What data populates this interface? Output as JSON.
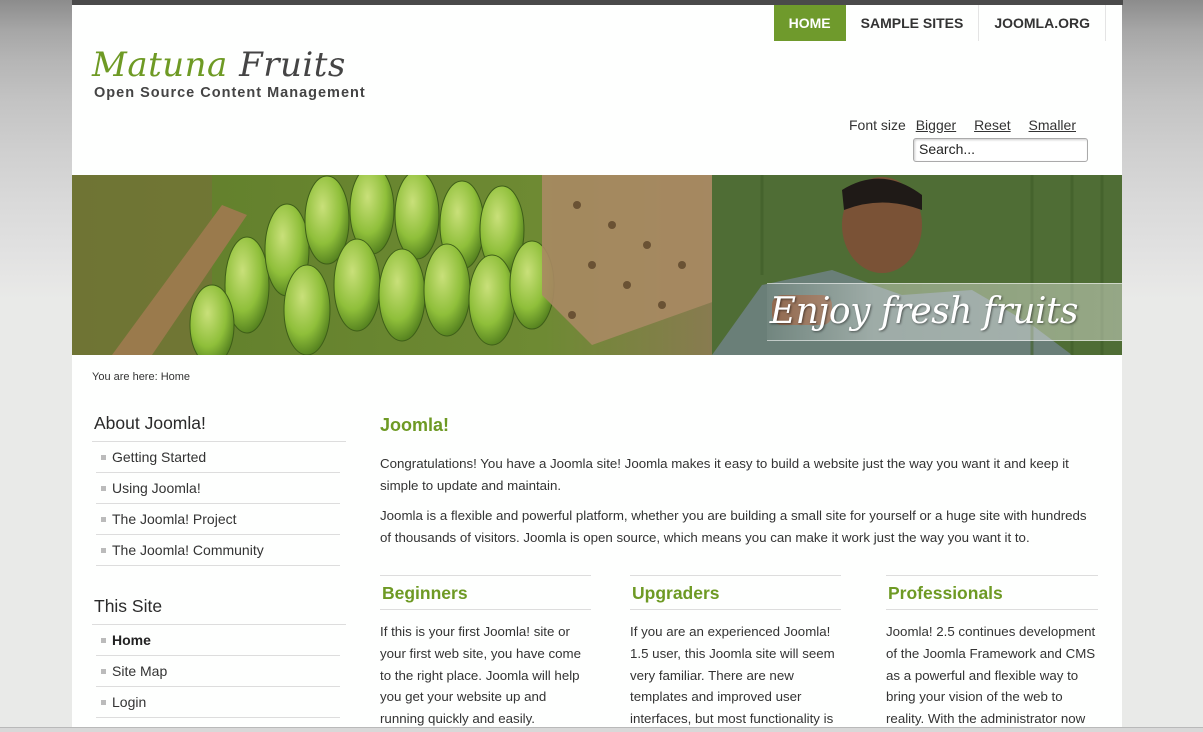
{
  "nav": {
    "items": [
      "HOME",
      "SAMPLE SITES",
      "JOOMLA.ORG"
    ]
  },
  "logo": {
    "word1": "Matuna",
    "word2": "Fruits",
    "tagline": "Open Source Content Management"
  },
  "tools": {
    "font_size_label": "Font size",
    "bigger": "Bigger",
    "reset": "Reset",
    "smaller": "Smaller"
  },
  "search": {
    "value": "Search..."
  },
  "banner": {
    "caption": "Enjoy fresh fruits"
  },
  "breadcrumb": "You are here: Home",
  "sidebar": {
    "about_title": "About Joomla!",
    "about_items": [
      "Getting Started",
      "Using Joomla!",
      "The Joomla! Project",
      "The Joomla! Community"
    ],
    "site_title": "This Site",
    "site_items": [
      "Home",
      "Site Map",
      "Login"
    ]
  },
  "main": {
    "title": "Joomla!",
    "para1": "Congratulations! You have a Joomla site! Joomla makes it easy to build a website just the way you want it and keep it simple to update and maintain.",
    "para2": "Joomla is a flexible and powerful platform, whether you are building a small site for yourself or a huge site with hundreds of thousands of visitors. Joomla is open source, which means you can make it work just the way you want it to.",
    "columns": [
      {
        "title": "Beginners",
        "text": "If this is your first Joomla! site or your first web site, you have come to the right place. Joomla will help you get your website up and running quickly and easily."
      },
      {
        "title": "Upgraders",
        "text": "If you are an experienced Joomla! 1.5 user, this Joomla site will seem very familiar. There are new templates and improved user interfaces, but most functionality is"
      },
      {
        "title": "Professionals",
        "text": "Joomla! 2.5 continues development of the Joomla Framework and CMS as a powerful and flexible way to bring your vision of the web to reality. With the administrator now"
      }
    ]
  },
  "colors": {
    "accent": "#6f9a2c",
    "text": "#333333"
  }
}
